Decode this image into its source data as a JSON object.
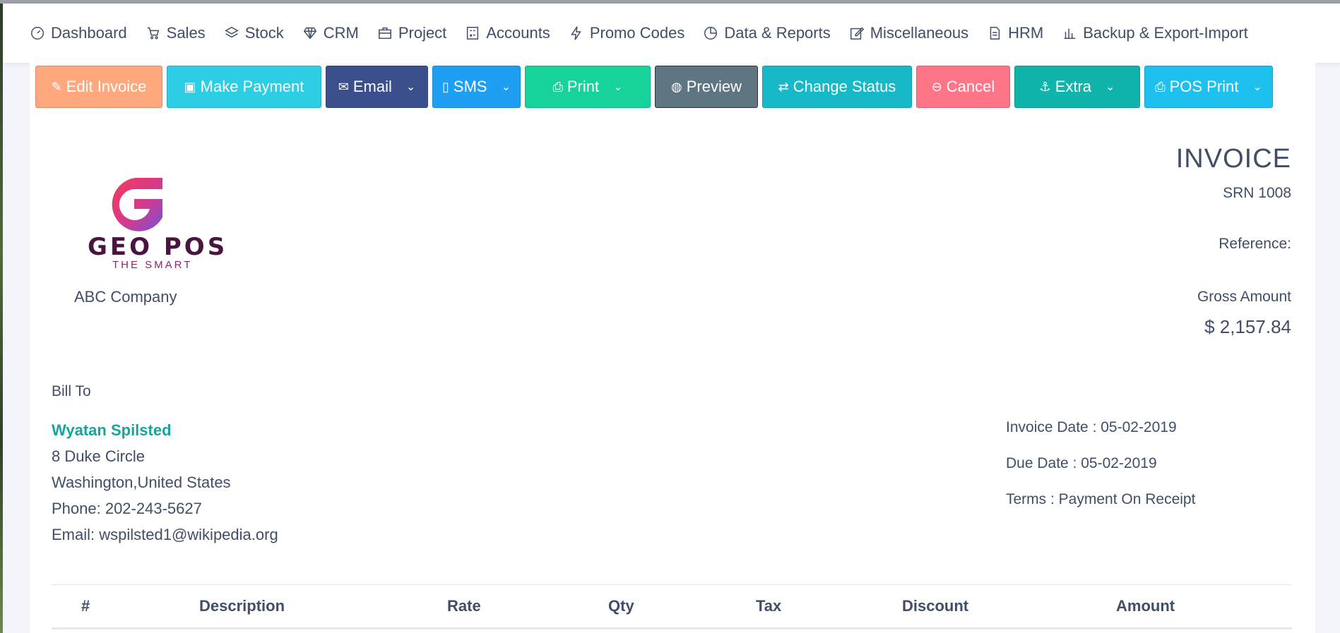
{
  "nav": [
    {
      "label": "Dashboard",
      "icon": "gauge-icon"
    },
    {
      "label": "Sales",
      "icon": "cart-icon"
    },
    {
      "label": "Stock",
      "icon": "layers-icon"
    },
    {
      "label": "CRM",
      "icon": "diamond-icon"
    },
    {
      "label": "Project",
      "icon": "briefcase-icon"
    },
    {
      "label": "Accounts",
      "icon": "calculator-icon"
    },
    {
      "label": "Promo Codes",
      "icon": "bolt-icon"
    },
    {
      "label": "Data & Reports",
      "icon": "pie-chart-icon"
    },
    {
      "label": "Miscellaneous",
      "icon": "edit-icon"
    },
    {
      "label": "HRM",
      "icon": "document-icon"
    },
    {
      "label": "Backup & Export-Import",
      "icon": "bar-chart-icon"
    }
  ],
  "toolbar": {
    "edit": "Edit Invoice",
    "payment": "Make Payment",
    "email": "Email",
    "sms": "SMS",
    "print": "Print",
    "preview": "Preview",
    "change_status": "Change Status",
    "cancel": "Cancel",
    "extra": "Extra",
    "pos_print": "POS Print"
  },
  "logo": {
    "name": "GEO POS",
    "tagline": "THE SMART"
  },
  "company": "ABC Company",
  "invoice": {
    "title": "INVOICE",
    "srn": "SRN 1008",
    "reference": "Reference:",
    "gross_label": "Gross Amount",
    "gross_amount": "$ 2,157.84",
    "invoice_date": "Invoice Date : 05-02-2019",
    "due_date": "Due Date : 05-02-2019",
    "terms": "Terms : Payment On Receipt"
  },
  "bill_to": {
    "label": "Bill To",
    "name": "Wyatan Spilsted",
    "address1": "8 Duke Circle",
    "address2": "Washington,United States",
    "phone": "Phone: 202-243-5627",
    "email": "Email: wspilsted1@wikipedia.org"
  },
  "table": {
    "headers": [
      "#",
      "Description",
      "Rate",
      "Qty",
      "Tax",
      "Discount",
      "Amount"
    ]
  },
  "colors": {
    "accent_teal": "#16a59c",
    "text": "#404e67"
  }
}
